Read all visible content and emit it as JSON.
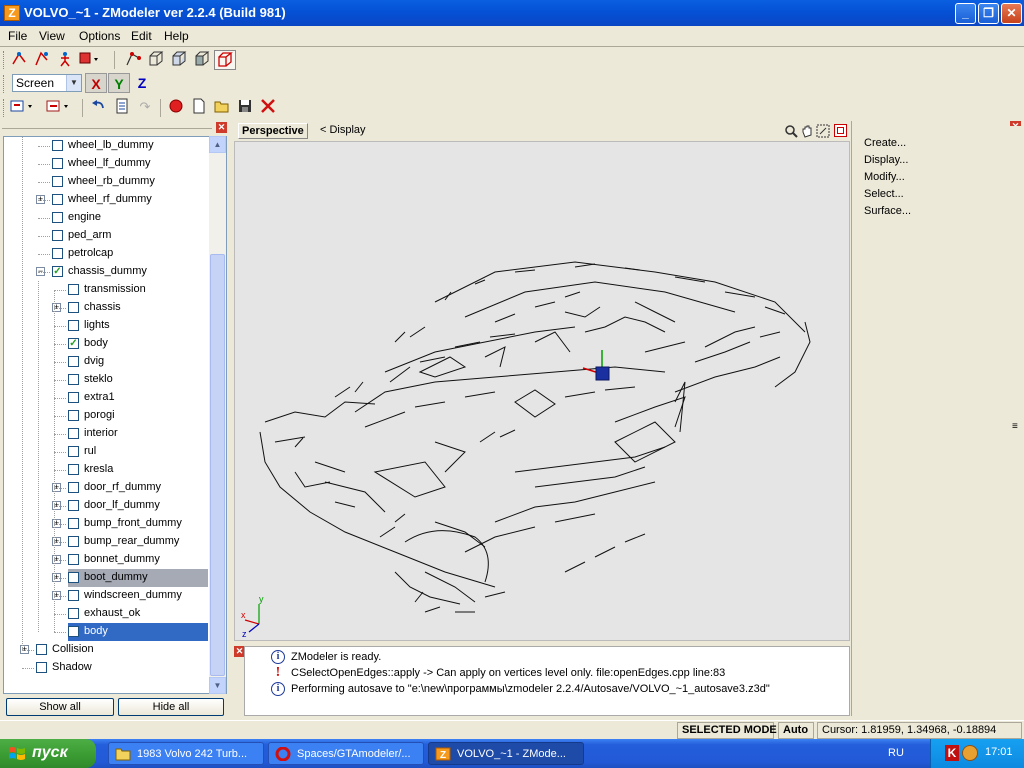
{
  "window": {
    "app_icon": "Z",
    "title": "VOLVO_~1 - ZModeler ver 2.2.4 (Build 981)",
    "minimize": "_",
    "maximize": "❐",
    "close": "✕"
  },
  "menu": [
    "File",
    "View",
    "Options",
    "Edit",
    "Help"
  ],
  "coord_system": {
    "selected": "Screen",
    "axes": [
      "X",
      "Y",
      "Z"
    ],
    "axis_colors": [
      "#c00000",
      "#008000",
      "#0000c0"
    ]
  },
  "tree": {
    "items": [
      {
        "label": "wheel_lb_dummy",
        "level": 1,
        "expandable": false,
        "checked": false,
        "state": ""
      },
      {
        "label": "wheel_lf_dummy",
        "level": 1,
        "expandable": false,
        "checked": false,
        "state": ""
      },
      {
        "label": "wheel_rb_dummy",
        "level": 1,
        "expandable": false,
        "checked": false,
        "state": ""
      },
      {
        "label": "wheel_rf_dummy",
        "level": 1,
        "expandable": true,
        "checked": false,
        "state": ""
      },
      {
        "label": "engine",
        "level": 1,
        "expandable": false,
        "checked": false,
        "state": ""
      },
      {
        "label": "ped_arm",
        "level": 1,
        "expandable": false,
        "checked": false,
        "state": ""
      },
      {
        "label": "petrolcap",
        "level": 1,
        "expandable": false,
        "checked": false,
        "state": ""
      },
      {
        "label": "chassis_dummy",
        "level": 1,
        "expandable": true,
        "expanded": true,
        "checked": true,
        "state": ""
      },
      {
        "label": "transmission",
        "level": 2,
        "expandable": false,
        "checked": false,
        "state": ""
      },
      {
        "label": "chassis",
        "level": 2,
        "expandable": true,
        "checked": false,
        "state": ""
      },
      {
        "label": "lights",
        "level": 2,
        "expandable": false,
        "checked": false,
        "state": ""
      },
      {
        "label": "body",
        "level": 2,
        "expandable": false,
        "checked": true,
        "state": ""
      },
      {
        "label": "dvig",
        "level": 2,
        "expandable": false,
        "checked": false,
        "state": ""
      },
      {
        "label": "steklo",
        "level": 2,
        "expandable": false,
        "checked": false,
        "state": ""
      },
      {
        "label": "extra1",
        "level": 2,
        "expandable": false,
        "checked": false,
        "state": ""
      },
      {
        "label": "porogi",
        "level": 2,
        "expandable": false,
        "checked": false,
        "state": ""
      },
      {
        "label": "interior",
        "level": 2,
        "expandable": false,
        "checked": false,
        "state": ""
      },
      {
        "label": "rul",
        "level": 2,
        "expandable": false,
        "checked": false,
        "state": ""
      },
      {
        "label": "kresla",
        "level": 2,
        "expandable": false,
        "checked": false,
        "state": ""
      },
      {
        "label": "door_rf_dummy",
        "level": 2,
        "expandable": true,
        "checked": false,
        "state": ""
      },
      {
        "label": "door_lf_dummy",
        "level": 2,
        "expandable": true,
        "checked": false,
        "state": ""
      },
      {
        "label": "bump_front_dummy",
        "level": 2,
        "expandable": true,
        "checked": false,
        "state": ""
      },
      {
        "label": "bump_rear_dummy",
        "level": 2,
        "expandable": true,
        "checked": false,
        "state": ""
      },
      {
        "label": "bonnet_dummy",
        "level": 2,
        "expandable": true,
        "checked": false,
        "state": ""
      },
      {
        "label": "boot_dummy",
        "level": 2,
        "expandable": true,
        "checked": false,
        "state": "sel-gray"
      },
      {
        "label": "windscreen_dummy",
        "level": 2,
        "expandable": true,
        "checked": false,
        "state": ""
      },
      {
        "label": "exhaust_ok",
        "level": 2,
        "expandable": false,
        "checked": false,
        "state": ""
      },
      {
        "label": "body",
        "level": 2,
        "expandable": false,
        "checked": false,
        "state": "sel-blue"
      },
      {
        "label": "Collision",
        "level": 0,
        "expandable": true,
        "checked": false,
        "state": ""
      },
      {
        "label": "Shadow",
        "level": 0,
        "expandable": false,
        "checked": false,
        "state": ""
      }
    ]
  },
  "buttons": {
    "show_all": "Show all",
    "hide_all": "Hide all"
  },
  "viewport": {
    "view_name": "Perspective",
    "display_menu": "<  Display",
    "axis_labels": [
      "x",
      "y",
      "z"
    ]
  },
  "log": [
    {
      "type": "info",
      "text": "ZModeler is ready."
    },
    {
      "type": "error",
      "text": "CSelectOpenEdges::apply -> Can apply on vertices level only. file:openEdges.cpp line:83"
    },
    {
      "type": "info",
      "text": "Performing autosave to \"e:\\new\\программы\\zmodeler 2.2.4/Autosave/VOLVO_~1_autosave3.z3d\""
    }
  ],
  "command_panel": [
    "Create...",
    "Display...",
    "Modify...",
    "Select...",
    "Surface..."
  ],
  "status": {
    "mode": "SELECTED MODE",
    "auto": "Auto",
    "cursor": "Cursor: 1.81959, 1.34968, -0.18894"
  },
  "taskbar": {
    "start": "пуск",
    "tasks": [
      {
        "label": "1983 Volvo 242 Turb...",
        "icon": "folder-icon"
      },
      {
        "label": "Spaces/GTAmodeler/...",
        "icon": "opera-icon"
      },
      {
        "label": "VOLVO_~1 - ZMode...",
        "icon": "zmodeler-icon",
        "active": true
      }
    ],
    "language": "RU",
    "clock": "17:01"
  }
}
